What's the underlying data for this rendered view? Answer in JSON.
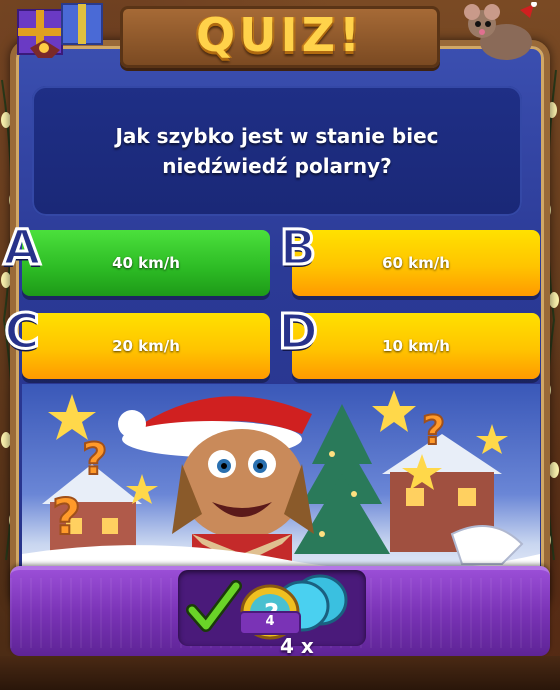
{
  "header": {
    "title": "QUIZ!"
  },
  "question": {
    "text": "Jak szybko jest w stanie biec niedźwiedź polarny?"
  },
  "answers": [
    {
      "letter": "A",
      "label": "40 km/h",
      "color": "#2cba24"
    },
    {
      "letter": "B",
      "label": "60 km/h",
      "color": "#ffc400"
    },
    {
      "letter": "C",
      "label": "20 km/h",
      "color": "#ffc400"
    },
    {
      "letter": "D",
      "label": "10 km/h",
      "color": "#ffc400"
    }
  ],
  "hint": {
    "count": "4",
    "multiplier": "4 x"
  },
  "colors": {
    "panel": "#2b3a96",
    "question_bg": "#1f2f86",
    "bottom_bar": "#7a33b6",
    "title": "#ffd24a"
  }
}
